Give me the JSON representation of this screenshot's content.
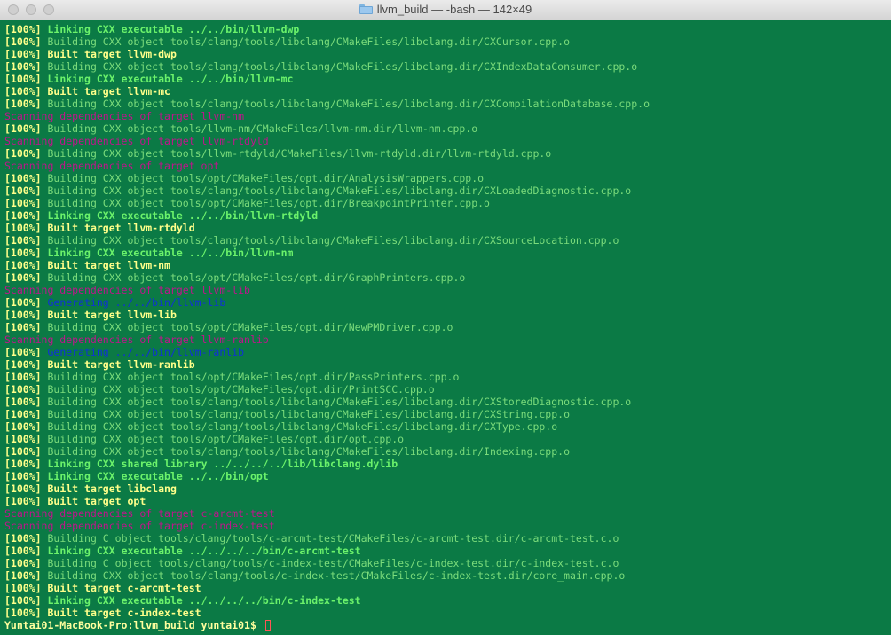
{
  "window": {
    "folder_icon": "folder-icon",
    "title": "llvm_build — -bash — 142×49"
  },
  "colors": {
    "background": "#0b7a45",
    "build": "#7bdc7b",
    "link": "#6bf26b",
    "target": "#ffff8a",
    "scan": "#c0148c",
    "generate": "#1030d8"
  },
  "lines": [
    {
      "p": "[100%]",
      "t": "Linking CXX executable ../../bin/llvm-dwp",
      "k": "link"
    },
    {
      "p": "[100%]",
      "t": "Building CXX object tools/clang/tools/libclang/CMakeFiles/libclang.dir/CXCursor.cpp.o",
      "k": "build"
    },
    {
      "p": "[100%]",
      "t": "Built target llvm-dwp",
      "k": "target"
    },
    {
      "p": "[100%]",
      "t": "Building CXX object tools/clang/tools/libclang/CMakeFiles/libclang.dir/CXIndexDataConsumer.cpp.o",
      "k": "build"
    },
    {
      "p": "[100%]",
      "t": "Linking CXX executable ../../bin/llvm-mc",
      "k": "link"
    },
    {
      "p": "[100%]",
      "t": "Built target llvm-mc",
      "k": "target"
    },
    {
      "p": "[100%]",
      "t": "Building CXX object tools/clang/tools/libclang/CMakeFiles/libclang.dir/CXCompilationDatabase.cpp.o",
      "k": "build"
    },
    {
      "p": "",
      "t": "Scanning dependencies of target llvm-nm",
      "k": "scan"
    },
    {
      "p": "[100%]",
      "t": "Building CXX object tools/llvm-nm/CMakeFiles/llvm-nm.dir/llvm-nm.cpp.o",
      "k": "build"
    },
    {
      "p": "",
      "t": "Scanning dependencies of target llvm-rtdyld",
      "k": "scan"
    },
    {
      "p": "[100%]",
      "t": "Building CXX object tools/llvm-rtdyld/CMakeFiles/llvm-rtdyld.dir/llvm-rtdyld.cpp.o",
      "k": "build"
    },
    {
      "p": "",
      "t": "Scanning dependencies of target opt",
      "k": "scan"
    },
    {
      "p": "[100%]",
      "t": "Building CXX object tools/opt/CMakeFiles/opt.dir/AnalysisWrappers.cpp.o",
      "k": "build"
    },
    {
      "p": "[100%]",
      "t": "Building CXX object tools/clang/tools/libclang/CMakeFiles/libclang.dir/CXLoadedDiagnostic.cpp.o",
      "k": "build"
    },
    {
      "p": "[100%]",
      "t": "Building CXX object tools/opt/CMakeFiles/opt.dir/BreakpointPrinter.cpp.o",
      "k": "build"
    },
    {
      "p": "[100%]",
      "t": "Linking CXX executable ../../bin/llvm-rtdyld",
      "k": "link"
    },
    {
      "p": "[100%]",
      "t": "Built target llvm-rtdyld",
      "k": "target"
    },
    {
      "p": "[100%]",
      "t": "Building CXX object tools/clang/tools/libclang/CMakeFiles/libclang.dir/CXSourceLocation.cpp.o",
      "k": "build"
    },
    {
      "p": "[100%]",
      "t": "Linking CXX executable ../../bin/llvm-nm",
      "k": "link"
    },
    {
      "p": "[100%]",
      "t": "Built target llvm-nm",
      "k": "target"
    },
    {
      "p": "[100%]",
      "t": "Building CXX object tools/opt/CMakeFiles/opt.dir/GraphPrinters.cpp.o",
      "k": "build"
    },
    {
      "p": "",
      "t": "Scanning dependencies of target llvm-lib",
      "k": "scan"
    },
    {
      "p": "[100%]",
      "t": "Generating ../../bin/llvm-lib",
      "k": "gen"
    },
    {
      "p": "[100%]",
      "t": "Built target llvm-lib",
      "k": "target"
    },
    {
      "p": "[100%]",
      "t": "Building CXX object tools/opt/CMakeFiles/opt.dir/NewPMDriver.cpp.o",
      "k": "build"
    },
    {
      "p": "",
      "t": "Scanning dependencies of target llvm-ranlib",
      "k": "scan"
    },
    {
      "p": "[100%]",
      "t": "Generating ../../bin/llvm-ranlib",
      "k": "gen"
    },
    {
      "p": "[100%]",
      "t": "Built target llvm-ranlib",
      "k": "target"
    },
    {
      "p": "[100%]",
      "t": "Building CXX object tools/opt/CMakeFiles/opt.dir/PassPrinters.cpp.o",
      "k": "build"
    },
    {
      "p": "[100%]",
      "t": "Building CXX object tools/opt/CMakeFiles/opt.dir/PrintSCC.cpp.o",
      "k": "build"
    },
    {
      "p": "[100%]",
      "t": "Building CXX object tools/clang/tools/libclang/CMakeFiles/libclang.dir/CXStoredDiagnostic.cpp.o",
      "k": "build"
    },
    {
      "p": "[100%]",
      "t": "Building CXX object tools/clang/tools/libclang/CMakeFiles/libclang.dir/CXString.cpp.o",
      "k": "build"
    },
    {
      "p": "[100%]",
      "t": "Building CXX object tools/clang/tools/libclang/CMakeFiles/libclang.dir/CXType.cpp.o",
      "k": "build"
    },
    {
      "p": "[100%]",
      "t": "Building CXX object tools/opt/CMakeFiles/opt.dir/opt.cpp.o",
      "k": "build"
    },
    {
      "p": "[100%]",
      "t": "Building CXX object tools/clang/tools/libclang/CMakeFiles/libclang.dir/Indexing.cpp.o",
      "k": "build"
    },
    {
      "p": "[100%]",
      "t": "Linking CXX shared library ../../../../lib/libclang.dylib",
      "k": "link"
    },
    {
      "p": "[100%]",
      "t": "Linking CXX executable ../../bin/opt",
      "k": "link"
    },
    {
      "p": "[100%]",
      "t": "Built target libclang",
      "k": "target"
    },
    {
      "p": "[100%]",
      "t": "Built target opt",
      "k": "target"
    },
    {
      "p": "",
      "t": "Scanning dependencies of target c-arcmt-test",
      "k": "scan"
    },
    {
      "p": "",
      "t": "Scanning dependencies of target c-index-test",
      "k": "scan"
    },
    {
      "p": "[100%]",
      "t": "Building C object tools/clang/tools/c-arcmt-test/CMakeFiles/c-arcmt-test.dir/c-arcmt-test.c.o",
      "k": "build"
    },
    {
      "p": "[100%]",
      "t": "Linking CXX executable ../../../../bin/c-arcmt-test",
      "k": "link"
    },
    {
      "p": "[100%]",
      "t": "Building C object tools/clang/tools/c-index-test/CMakeFiles/c-index-test.dir/c-index-test.c.o",
      "k": "build"
    },
    {
      "p": "[100%]",
      "t": "Building CXX object tools/clang/tools/c-index-test/CMakeFiles/c-index-test.dir/core_main.cpp.o",
      "k": "build"
    },
    {
      "p": "[100%]",
      "t": "Built target c-arcmt-test",
      "k": "target"
    },
    {
      "p": "[100%]",
      "t": "Linking CXX executable ../../../../bin/c-index-test",
      "k": "link"
    },
    {
      "p": "[100%]",
      "t": "Built target c-index-test",
      "k": "target"
    }
  ],
  "prompt": "Yuntai01-MacBook-Pro:llvm_build yuntai01$ "
}
